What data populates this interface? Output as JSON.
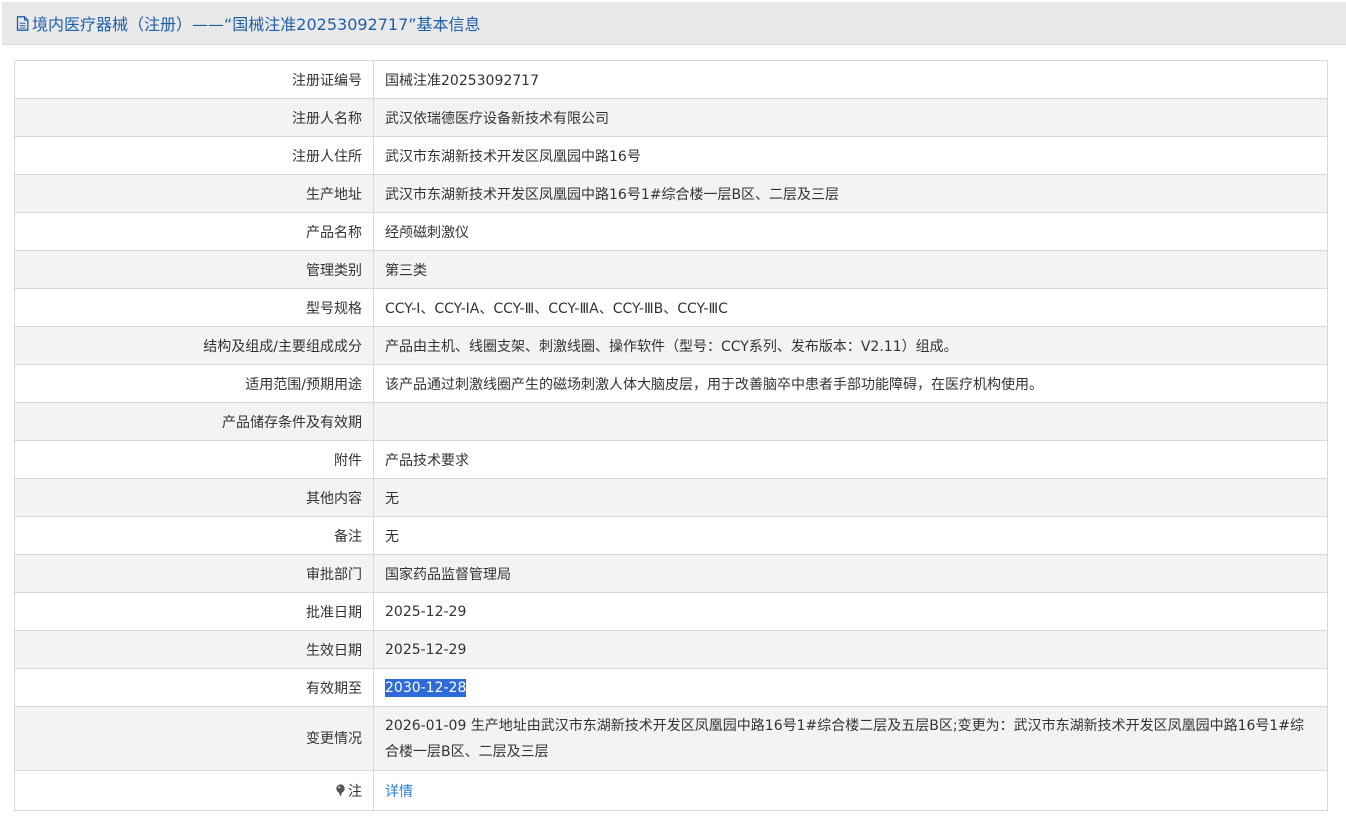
{
  "header": {
    "title": "境内医疗器械（注册）——“国械注准20253092717”基本信息"
  },
  "rows": [
    {
      "label": "注册证编号",
      "value": "国械注准20253092717"
    },
    {
      "label": "注册人名称",
      "value": "武汉依瑞德医疗设备新技术有限公司"
    },
    {
      "label": "注册人住所",
      "value": "武汉市东湖新技术开发区凤凰园中路16号"
    },
    {
      "label": "生产地址",
      "value": "武汉市东湖新技术开发区凤凰园中路16号1#综合楼一层B区、二层及三层"
    },
    {
      "label": "产品名称",
      "value": "经颅磁刺激仪"
    },
    {
      "label": "管理类别",
      "value": "第三类"
    },
    {
      "label": "型号规格",
      "value": "CCY-I、CCY-IA、CCY-Ⅲ、CCY-ⅢA、CCY-ⅢB、CCY-ⅢC"
    },
    {
      "label": "结构及组成/主要组成成分",
      "value": "产品由主机、线圈支架、刺激线圈、操作软件（型号：CCY系列、发布版本：V2.11）组成。"
    },
    {
      "label": "适用范围/预期用途",
      "value": "该产品通过刺激线圈产生的磁场刺激人体大脑皮层，用于改善脑卒中患者手部功能障碍，在医疗机构使用。"
    },
    {
      "label": "产品储存条件及有效期",
      "value": ""
    },
    {
      "label": "附件",
      "value": "产品技术要求"
    },
    {
      "label": "其他内容",
      "value": "无"
    },
    {
      "label": "备注",
      "value": "无"
    },
    {
      "label": "审批部门",
      "value": "国家药品监督管理局"
    },
    {
      "label": "批准日期",
      "value": "2025-12-29"
    },
    {
      "label": "生效日期",
      "value": "2025-12-29"
    },
    {
      "label": "有效期至",
      "value": "2030-12-28"
    },
    {
      "label": "变更情况",
      "value": "2026-01-09 生产地址由武汉市东湖新技术开发区凤凰园中路16号1#综合楼二层及五层B区;变更为：武汉市东湖新技术开发区凤凰园中路16号1#综合楼一层B区、二层及三层"
    }
  ],
  "note": {
    "label": "注",
    "link_text": "详情"
  },
  "colors": {
    "title_text": "#1f5fa8",
    "selection_bg": "#2f6bd8",
    "link": "#2a7fd4"
  },
  "icons": {
    "title_icon": "document-icon",
    "note_icon": "pin-icon"
  }
}
